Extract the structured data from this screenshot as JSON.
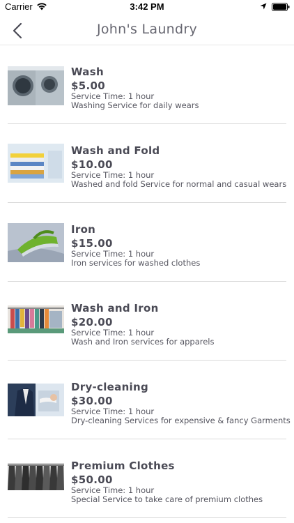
{
  "status_bar": {
    "carrier": "Carrier",
    "time": "3:42 PM",
    "icons": [
      "wifi-icon",
      "location-icon",
      "battery-icon"
    ]
  },
  "nav": {
    "title": "John's Laundry",
    "back_icon": "chevron-left-icon"
  },
  "services": [
    {
      "name": "Wash",
      "price": "$5.00",
      "time": "Service Time: 1 hour",
      "description": "Washing Service for daily wears",
      "image": "washing-machine-image"
    },
    {
      "name": "Wash and Fold",
      "price": "$10.00",
      "time": "Service Time: 1 hour",
      "description": "Washed and fold Service for normal and casual wears",
      "image": "folded-towels-image"
    },
    {
      "name": "Iron",
      "price": "$15.00",
      "time": "Service Time: 1 hour",
      "description": "Iron services for washed clothes",
      "image": "green-iron-image"
    },
    {
      "name": "Wash and Iron",
      "price": "$20.00",
      "time": "Service Time: 1 hour",
      "description": "Wash and Iron services for apparels",
      "image": "clothes-rack-image"
    },
    {
      "name": "Dry-cleaning",
      "price": "$30.00",
      "time": "Service Time: 1 hour",
      "description": "Dry-cleaning Services for expensive & fancy Garments",
      "image": "suit-steaming-image"
    },
    {
      "name": "Premium Clothes",
      "price": "$50.00",
      "time": "Service Time: 1 hour",
      "description": "Special Service to take care of premium clothes",
      "image": "hanging-jackets-image"
    }
  ]
}
